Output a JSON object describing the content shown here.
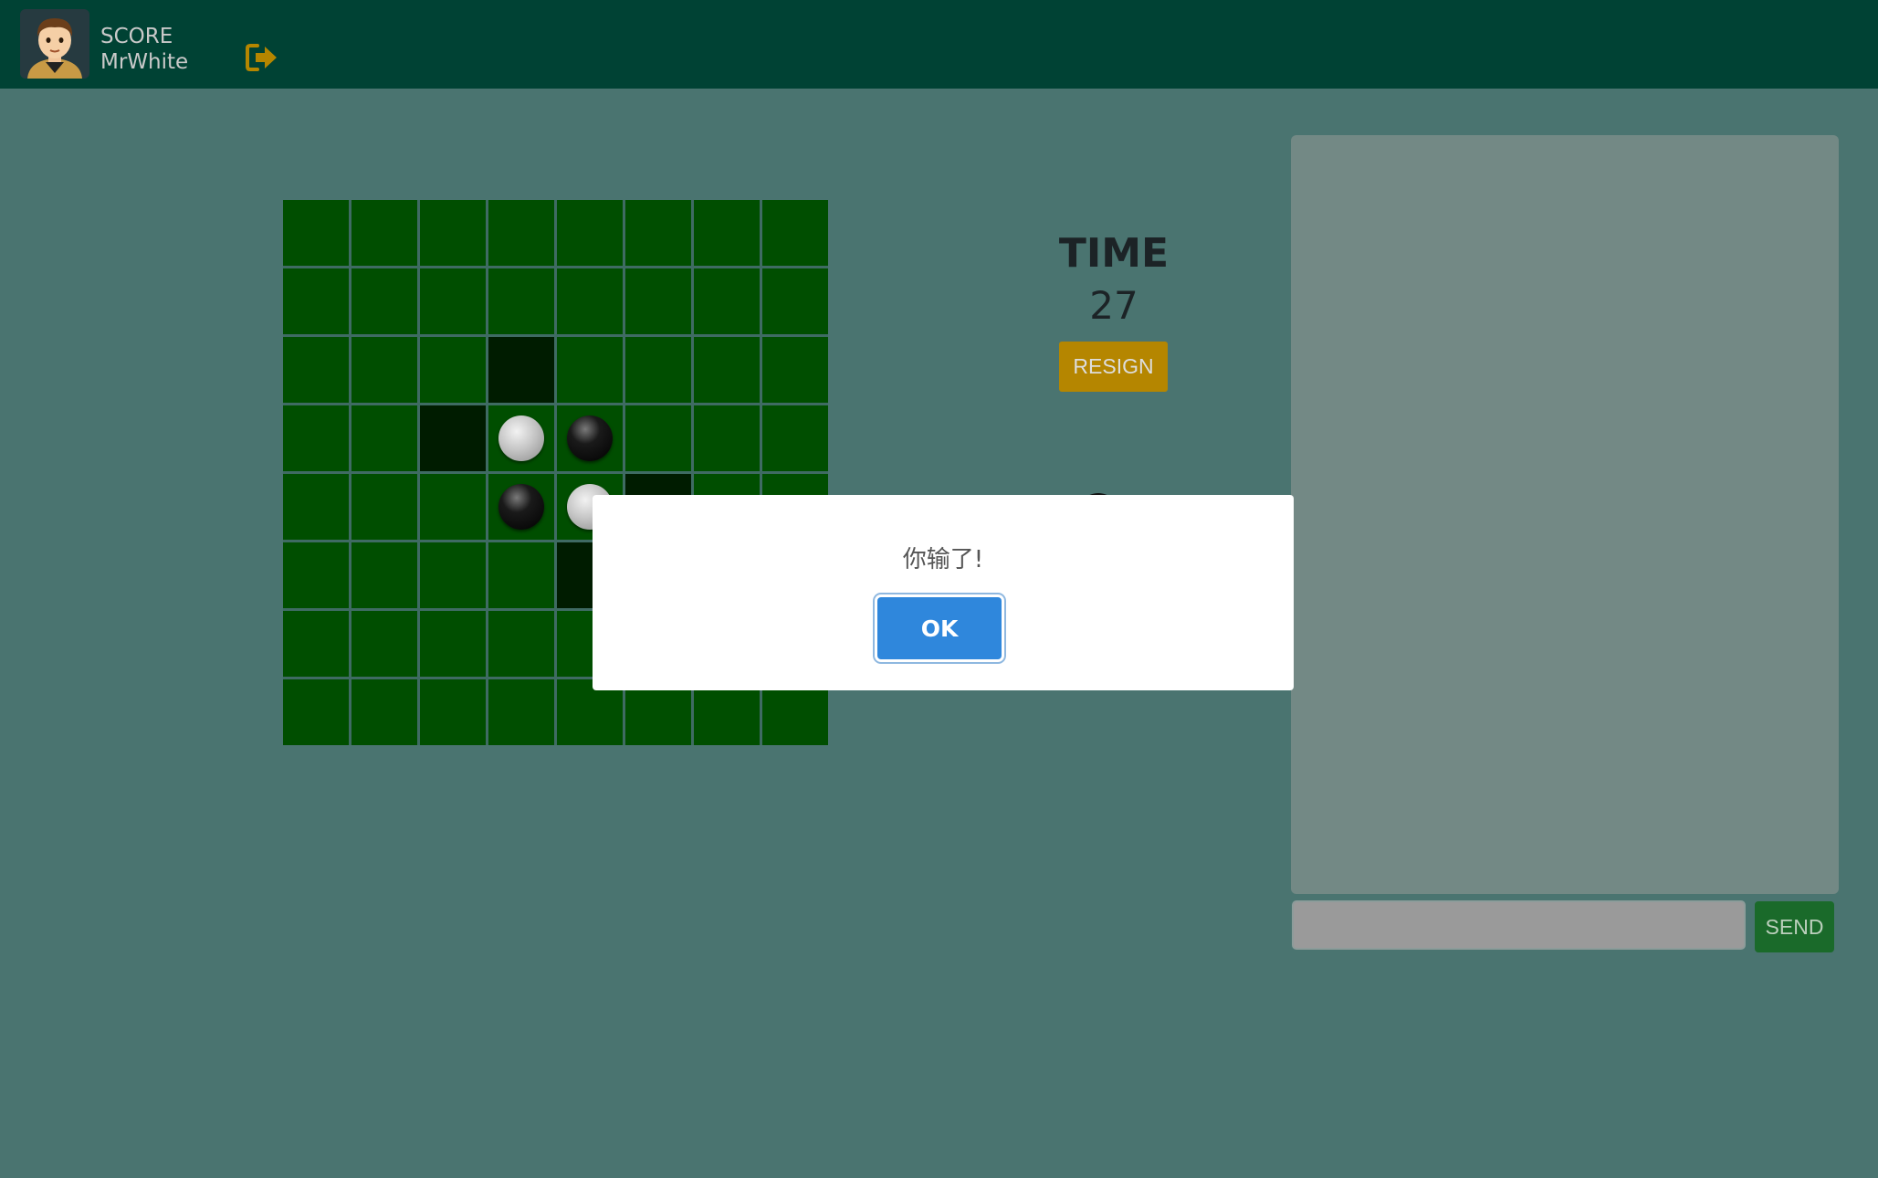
{
  "header": {
    "score_label": "SCORE",
    "username": "MrWhite",
    "avatar_icon": "avatar-man-icon",
    "logout_icon": "sign-out-icon",
    "accent_color": "#b58600"
  },
  "game": {
    "time_label": "TIME",
    "time_value": "27",
    "resign_label": "RESIGN",
    "board": [
      [
        "",
        "",
        "",
        "",
        "",
        "",
        "",
        ""
      ],
      [
        "",
        "",
        "",
        "",
        "",
        "",
        "",
        ""
      ],
      [
        "",
        "",
        "",
        "hint",
        "",
        "",
        "",
        ""
      ],
      [
        "",
        "",
        "hint",
        "white",
        "black",
        "",
        "",
        ""
      ],
      [
        "",
        "",
        "",
        "black",
        "white",
        "hint",
        "",
        ""
      ],
      [
        "",
        "",
        "",
        "",
        "hint",
        "",
        "",
        ""
      ],
      [
        "",
        "",
        "",
        "",
        "",
        "",
        "",
        ""
      ],
      [
        "",
        "",
        "",
        "",
        "",
        "",
        "",
        ""
      ]
    ]
  },
  "chat": {
    "input_value": "",
    "send_label": "SEND"
  },
  "dialog": {
    "message": "你输了!",
    "ok_label": "OK"
  }
}
